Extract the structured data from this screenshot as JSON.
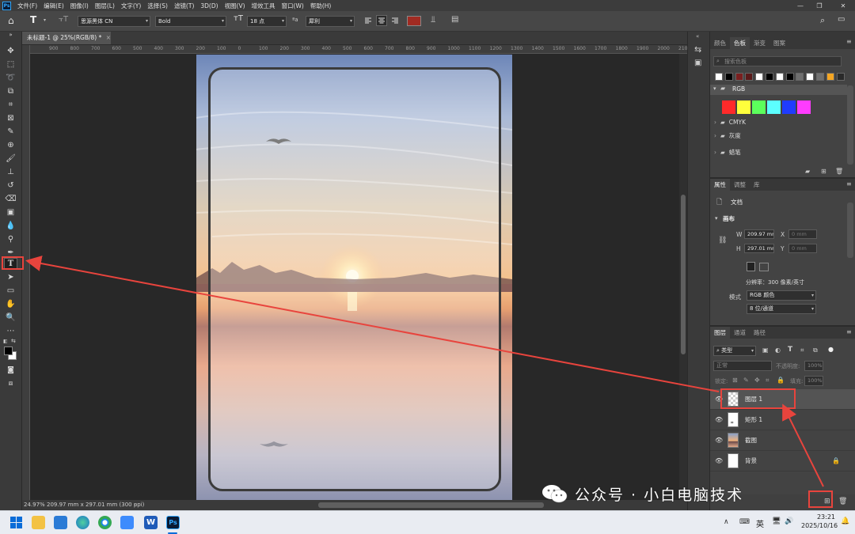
{
  "menubar": {
    "items": [
      "文件(F)",
      "编辑(E)",
      "图像(I)",
      "图层(L)",
      "文字(Y)",
      "选择(S)",
      "滤镜(T)",
      "3D(D)",
      "视图(V)",
      "增效工具",
      "窗口(W)",
      "帮助(H)"
    ],
    "controls": [
      "—",
      "❐",
      "✕"
    ]
  },
  "options": {
    "font_family": "思源黑体 CN",
    "font_style": "Bold",
    "font_size": "18 点",
    "antialias": "犀利",
    "aa_icon": "ªa",
    "font_color": "#a12b22"
  },
  "document": {
    "tab": "未标题-1 @ 25%(RGB/8) *"
  },
  "ruler": {
    "marks": [
      "900",
      "800",
      "700",
      "600",
      "500",
      "400",
      "300",
      "200",
      "100",
      "0",
      "100",
      "200",
      "300",
      "400",
      "500",
      "600",
      "700",
      "800",
      "900",
      "1000",
      "1100",
      "1200",
      "1300",
      "1400",
      "1500",
      "1600",
      "1700",
      "1800",
      "1900",
      "2000",
      "2100"
    ]
  },
  "status": {
    "zoom": "24.97%",
    "doc_size": "209.97 mm x 297.01 mm (300 ppi)"
  },
  "swatches_panel": {
    "tabs": [
      "颜色",
      "色板",
      "渐变",
      "图案"
    ],
    "search_placeholder": "搜索色板",
    "recent": [
      "#ffffff",
      "#000000",
      "#7a1f1f",
      "#5a1a1a",
      "#ffffff",
      "#000000",
      "#ffffff",
      "#000000",
      "#6f6f6f",
      "#ffffff",
      "#6f6f6f",
      "#f5a623",
      "#2a2a2a"
    ],
    "groups": [
      {
        "name": "RGB",
        "colors": [
          "#ff2a2a",
          "#ffff3c",
          "#5cff5c",
          "#5cffff",
          "#1f3cff",
          "#ff3cff"
        ]
      },
      {
        "name": "CMYK"
      },
      {
        "name": "灰度"
      },
      {
        "name": "蜡笔"
      }
    ]
  },
  "properties_panel": {
    "tabs": [
      "属性",
      "调整",
      "库"
    ],
    "kind": "文档",
    "section": "画布",
    "w_label": "W",
    "w_value": "209.97 mm",
    "h_label": "H",
    "h_value": "297.01 mm",
    "x_label": "X",
    "x_placeholder": "0 mm",
    "y_label": "Y",
    "y_placeholder": "0 mm",
    "resolution": "分辨率：300 像素/英寸",
    "mode_label": "模式",
    "mode_value": "RGB 颜色",
    "depth_value": "8 位/通道"
  },
  "layers_panel": {
    "tabs": [
      "图层",
      "通道",
      "路径"
    ],
    "filter": "类型",
    "blend": "正常",
    "opacity_label": "不透明度:",
    "opacity_value": "100%",
    "lock_label": "锁定:",
    "fill_label": "填充:",
    "fill_value": "100%",
    "layers": [
      {
        "name": "图层 1",
        "selected": true
      },
      {
        "name": "矩形 1",
        "selected": false
      },
      {
        "name": "截图",
        "selected": false
      },
      {
        "name": "背景",
        "selected": false
      }
    ]
  },
  "taskbar": {
    "ime": "英",
    "time": "23:21",
    "date": "2025/10/16"
  },
  "watermark": {
    "text": "公众号 · 小白电脑技术"
  },
  "colors": {
    "annotation": "#e8443d",
    "accent": "#31a8ff"
  }
}
